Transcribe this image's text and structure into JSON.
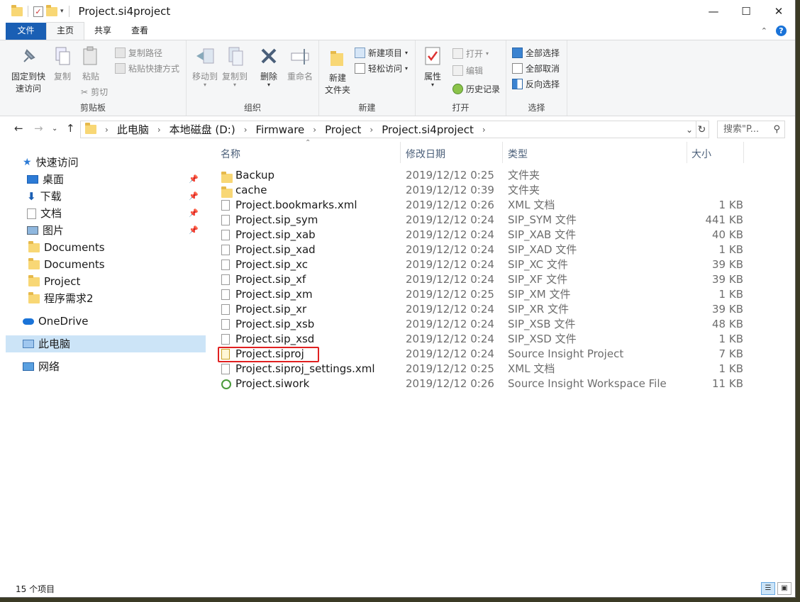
{
  "window": {
    "title": "Project.si4project",
    "controls": {
      "minimize": "—",
      "maximize": "☐",
      "close": "✕"
    }
  },
  "ribbon_tabs": [
    "文件",
    "主页",
    "共享",
    "查看"
  ],
  "ribbon": {
    "clipboard": {
      "pin_label": "固定到快\n速访问",
      "copy": "复制",
      "paste": "粘贴",
      "copy_path": "复制路径",
      "paste_shortcut": "粘贴快捷方式",
      "cut": "剪切",
      "label": "剪贴板"
    },
    "organize": {
      "move_to": "移动到",
      "copy_to": "复制到",
      "delete": "删除",
      "rename": "重命名",
      "label": "组织"
    },
    "new": {
      "new_folder": "新建\n文件夹",
      "new_item": "新建项目",
      "easy_access": "轻松访问",
      "label": "新建"
    },
    "open": {
      "properties": "属性",
      "open": "打开",
      "edit": "编辑",
      "history": "历史记录",
      "label": "打开"
    },
    "select": {
      "select_all": "全部选择",
      "select_none": "全部取消",
      "invert": "反向选择",
      "label": "选择"
    }
  },
  "address": {
    "crumbs": [
      "此电脑",
      "本地磁盘 (D:)",
      "Firmware",
      "Project",
      "Project.si4project"
    ],
    "search_placeholder": "搜索\"P..."
  },
  "sidebar": {
    "quick_access": "快速访问",
    "items": [
      {
        "label": "桌面",
        "pinned": true
      },
      {
        "label": "下载",
        "pinned": true
      },
      {
        "label": "文档",
        "pinned": true
      },
      {
        "label": "图片",
        "pinned": true
      },
      {
        "label": "Documents"
      },
      {
        "label": "Documents"
      },
      {
        "label": "Project"
      },
      {
        "label": "程序需求2"
      }
    ],
    "onedrive": "OneDrive",
    "this_pc": "此电脑",
    "network": "网络"
  },
  "columns": {
    "name": "名称",
    "date": "修改日期",
    "type": "类型",
    "size": "大小"
  },
  "files": [
    {
      "name": "Backup",
      "date": "2019/12/12 0:25",
      "type": "文件夹",
      "size": "",
      "icon": "folder"
    },
    {
      "name": "cache",
      "date": "2019/12/12 0:39",
      "type": "文件夹",
      "size": "",
      "icon": "folder"
    },
    {
      "name": "Project.bookmarks.xml",
      "date": "2019/12/12 0:26",
      "type": "XML 文档",
      "size": "1 KB",
      "icon": "file"
    },
    {
      "name": "Project.sip_sym",
      "date": "2019/12/12 0:24",
      "type": "SIP_SYM 文件",
      "size": "441 KB",
      "icon": "file"
    },
    {
      "name": "Project.sip_xab",
      "date": "2019/12/12 0:24",
      "type": "SIP_XAB 文件",
      "size": "40 KB",
      "icon": "file"
    },
    {
      "name": "Project.sip_xad",
      "date": "2019/12/12 0:24",
      "type": "SIP_XAD 文件",
      "size": "1 KB",
      "icon": "file"
    },
    {
      "name": "Project.sip_xc",
      "date": "2019/12/12 0:24",
      "type": "SIP_XC 文件",
      "size": "39 KB",
      "icon": "file"
    },
    {
      "name": "Project.sip_xf",
      "date": "2019/12/12 0:24",
      "type": "SIP_XF 文件",
      "size": "39 KB",
      "icon": "file"
    },
    {
      "name": "Project.sip_xm",
      "date": "2019/12/12 0:25",
      "type": "SIP_XM 文件",
      "size": "1 KB",
      "icon": "file"
    },
    {
      "name": "Project.sip_xr",
      "date": "2019/12/12 0:24",
      "type": "SIP_XR 文件",
      "size": "39 KB",
      "icon": "file"
    },
    {
      "name": "Project.sip_xsb",
      "date": "2019/12/12 0:24",
      "type": "SIP_XSB 文件",
      "size": "48 KB",
      "icon": "file"
    },
    {
      "name": "Project.sip_xsd",
      "date": "2019/12/12 0:24",
      "type": "SIP_XSD 文件",
      "size": "1 KB",
      "icon": "file"
    },
    {
      "name": "Project.siproj",
      "date": "2019/12/12 0:24",
      "type": "Source Insight Project",
      "size": "7 KB",
      "icon": "siproj"
    },
    {
      "name": "Project.siproj_settings.xml",
      "date": "2019/12/12 0:25",
      "type": "XML 文档",
      "size": "1 KB",
      "icon": "file"
    },
    {
      "name": "Project.siwork",
      "date": "2019/12/12 0:26",
      "type": "Source Insight Workspace File",
      "size": "11 KB",
      "icon": "siwork"
    }
  ],
  "status": {
    "count": "15 个项目"
  },
  "colors": {
    "accent": "#1a5fb4",
    "selection": "#cce4f7",
    "highlight_box": "#e02020"
  }
}
